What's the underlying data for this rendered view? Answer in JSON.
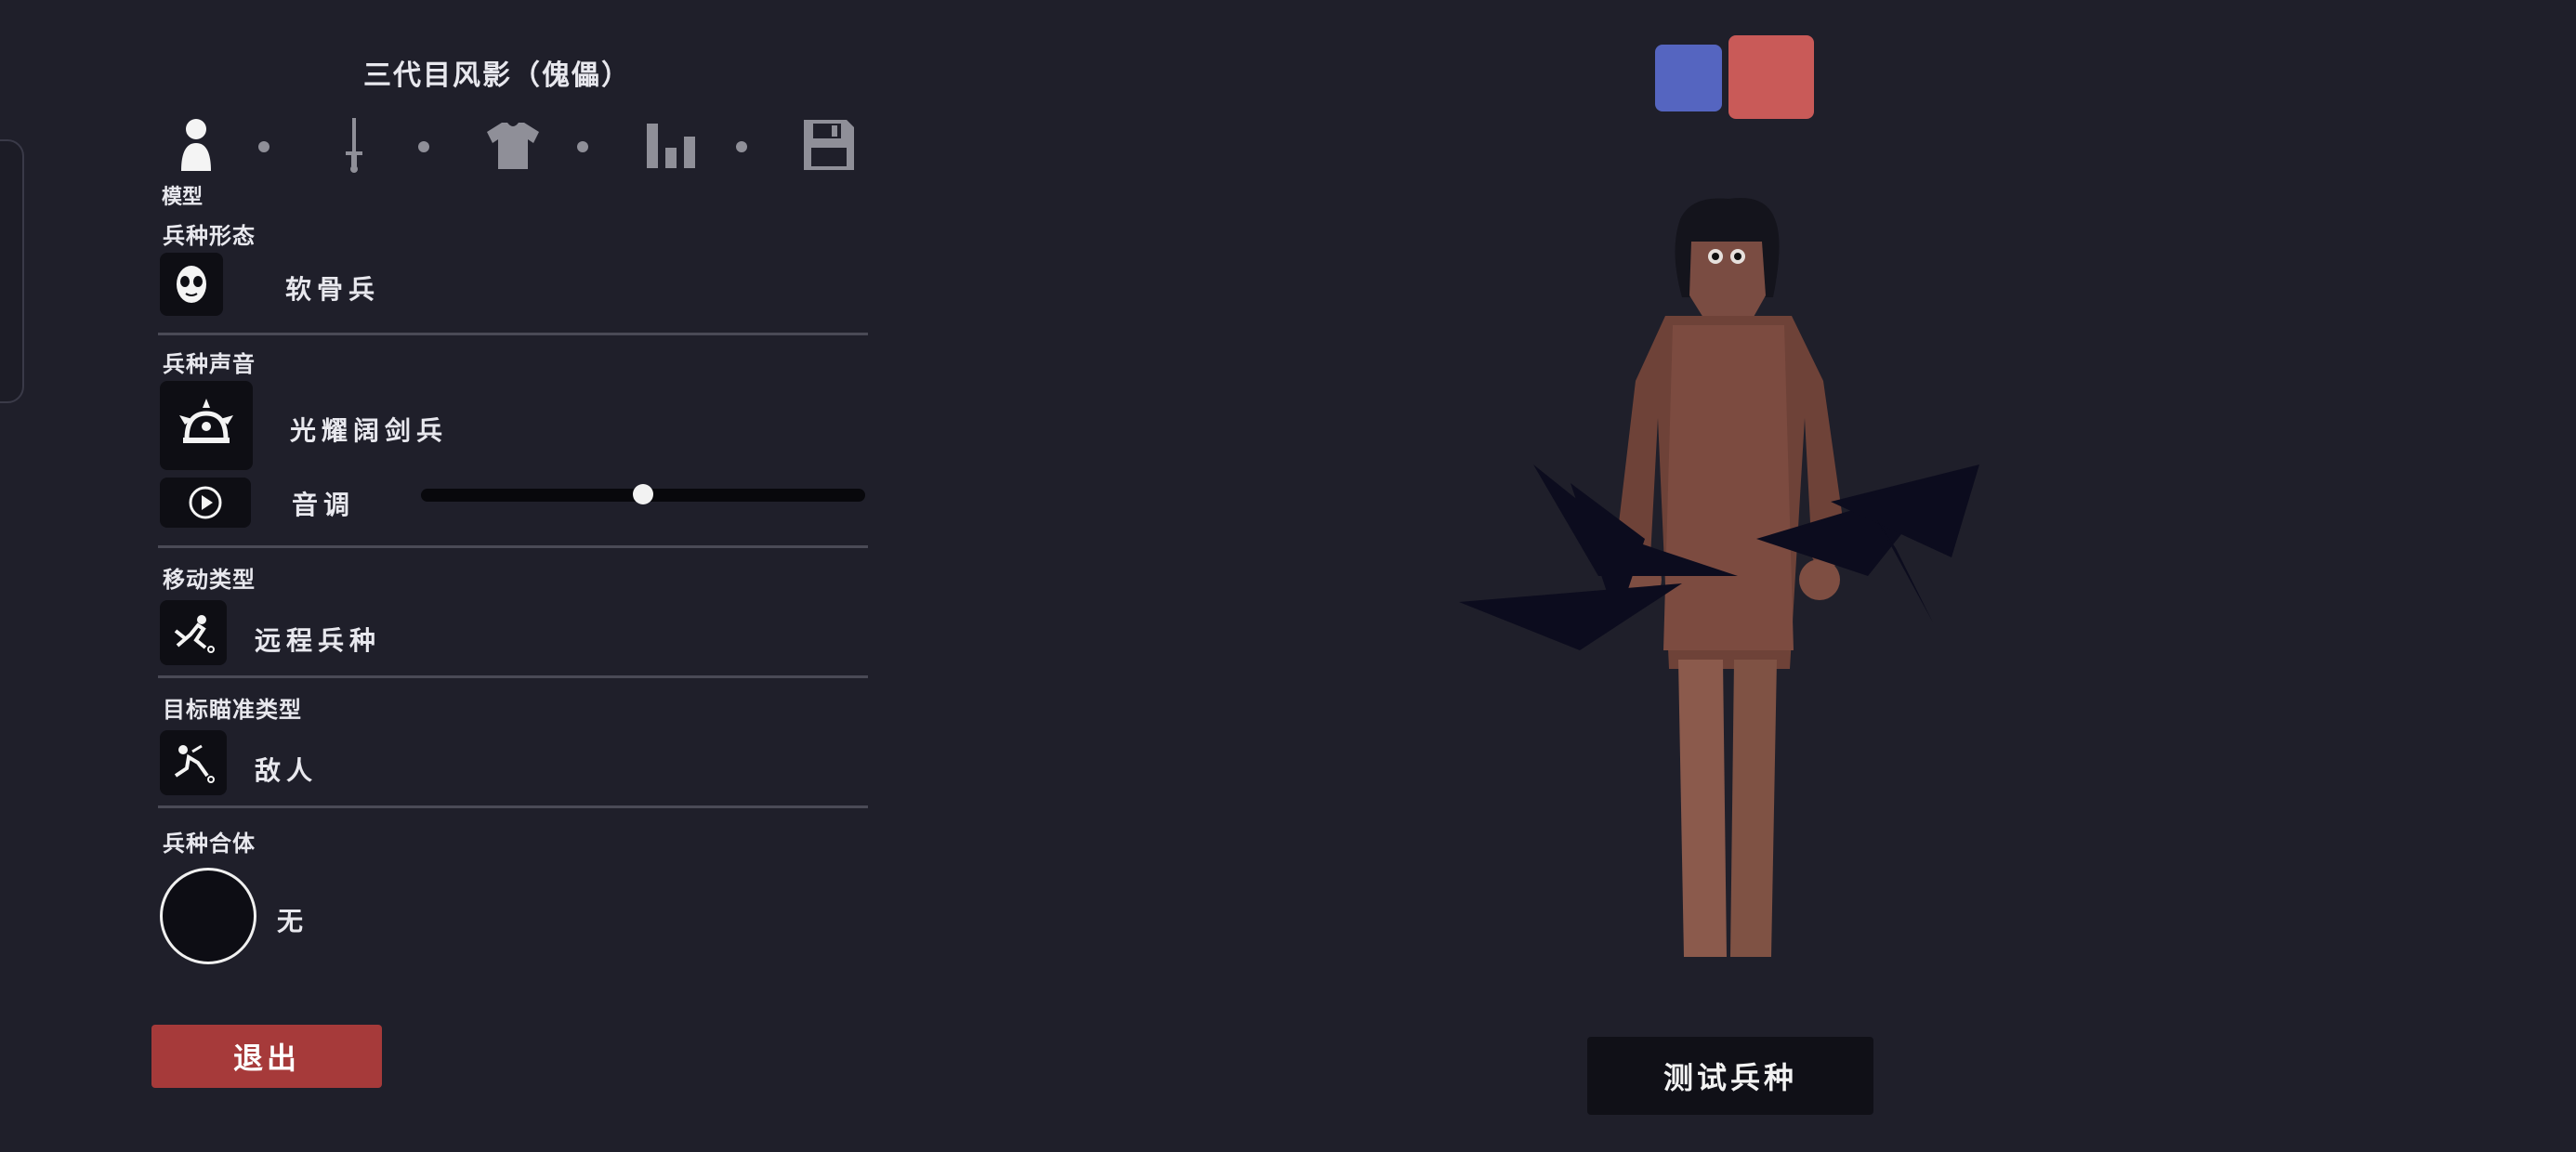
{
  "unit": {
    "title": "三代目风影（傀儡）"
  },
  "tabs": {
    "active_label": "模型",
    "items": [
      {
        "icon": "person-icon"
      },
      {
        "icon": "sword-icon"
      },
      {
        "icon": "shirt-icon"
      },
      {
        "icon": "bar-chart-icon"
      },
      {
        "icon": "save-icon"
      }
    ]
  },
  "sections": {
    "form": {
      "title": "兵种形态",
      "value": "软骨兵",
      "icon": "mask-face-icon"
    },
    "voice": {
      "title": "兵种声音",
      "value": "光耀阔剑兵",
      "icon": "halo-crown-icon",
      "pitch_label": "音调",
      "play_icon": "play-icon",
      "pitch_level": 0.5
    },
    "movement": {
      "title": "移动类型",
      "value": "远程兵种",
      "icon": "movement-icon"
    },
    "targeting": {
      "title": "目标瞄准类型",
      "value": "敌人",
      "icon": "target-icon"
    },
    "fusion": {
      "title": "兵种合体",
      "value": "无"
    }
  },
  "buttons": {
    "exit": "退出",
    "test": "测试兵种"
  },
  "colors": {
    "background": "#1f1f2a",
    "team_blue": "#5565c0",
    "team_red": "#c95a58",
    "exit": "#a63a3a",
    "body": "#8a5a4c"
  }
}
